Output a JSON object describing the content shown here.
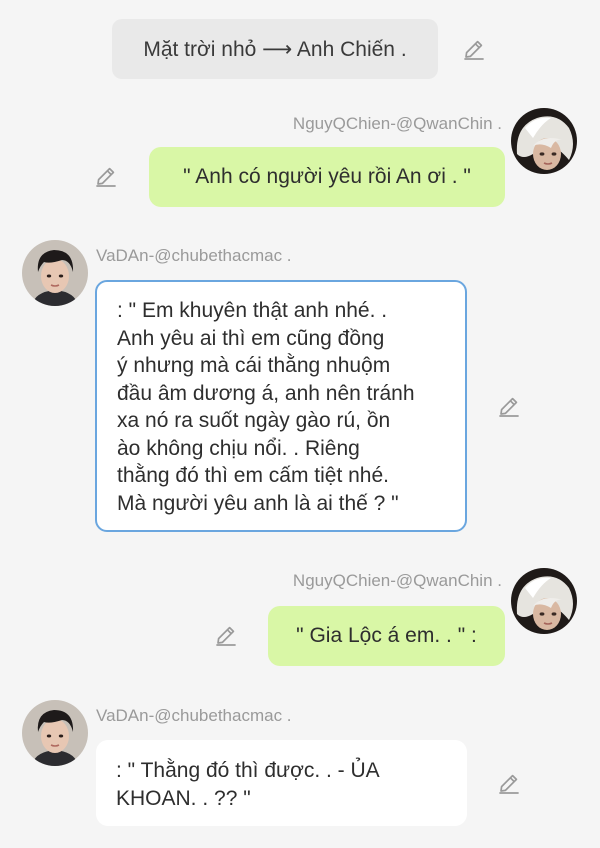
{
  "system_message": "Mặt trời nhỏ ⟶ Anh Chiến .",
  "messages": [
    {
      "side": "right",
      "sender": "NguyQChien-@QwanChin .",
      "text": "\" Anh có người yêu rồi An ơi . \""
    },
    {
      "side": "left",
      "sender": "VaDAn-@chubethacmac .",
      "lines": [
        ": \" Em khuyên thật anh nhé. .",
        "Anh yêu ai thì em cũng đồng",
        "ý nhưng mà cái thằng nhuộm",
        "đầu âm dương á, anh nên tránh",
        "xa nó ra suốt ngày gào rú, ồn",
        "ào không chịu nổi. . Riêng",
        "thằng đó thì em cấm tiệt nhé.",
        "Mà người yêu anh là ai thế ? \""
      ]
    },
    {
      "side": "right",
      "sender": "NguyQChien-@QwanChin .",
      "text": "\" Gia Lộc á em. . \" :"
    },
    {
      "side": "left",
      "sender": "VaDAn-@chubethacmac .",
      "lines": [
        ": \" Thằng đó thì được. . - ỦA",
        "KHOAN. . ?? \""
      ]
    }
  ],
  "icons": {
    "edit": "pencil-icon",
    "avatar_right": "white-haired-avatar",
    "avatar_left": "dark-haired-avatar"
  },
  "colors": {
    "background": "#f5f5f5",
    "system_pill": "#e9e9e9",
    "right_bubble": "#d9f7a6",
    "left_bubble": "#ffffff",
    "selected_border": "#6aa6df",
    "sender_name": "#9a9a9a"
  }
}
